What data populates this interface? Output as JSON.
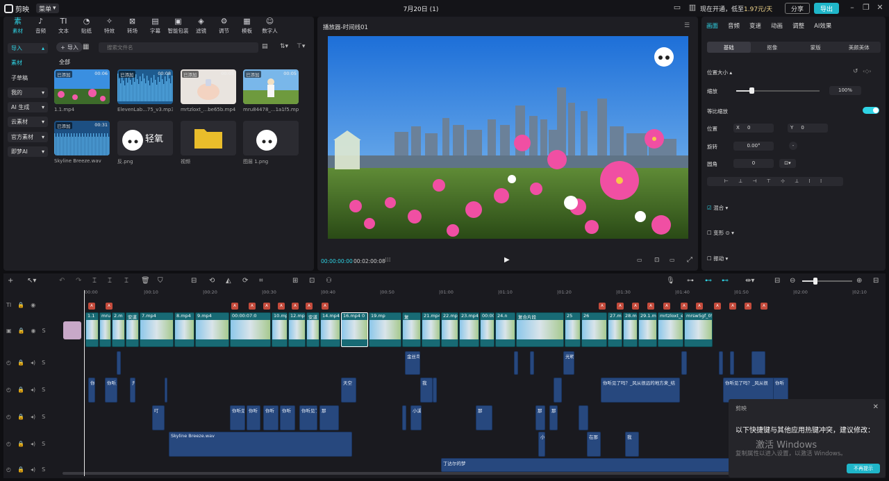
{
  "app": {
    "name": "剪映",
    "menu_label": "菜单",
    "doc_title": "7月20日 (1)",
    "promo_prefix": "现在开通，低至",
    "promo_price": "1.97元/天",
    "share": "分享",
    "export": "导出"
  },
  "toolbar_tabs": [
    {
      "label": "素材",
      "icon": "素"
    },
    {
      "label": "音频",
      "icon": "♪"
    },
    {
      "label": "文本",
      "icon": "TI"
    },
    {
      "label": "贴纸",
      "icon": "◔"
    },
    {
      "label": "特效",
      "icon": "✧"
    },
    {
      "label": "转场",
      "icon": "⊠"
    },
    {
      "label": "字幕",
      "icon": "▤"
    },
    {
      "label": "智能包装",
      "icon": "▣"
    },
    {
      "label": "滤镜",
      "icon": "◈"
    },
    {
      "label": "调节",
      "icon": "⚙"
    },
    {
      "label": "模板",
      "icon": "▦"
    },
    {
      "label": "数字人",
      "icon": "☺"
    }
  ],
  "sidebar": [
    {
      "label": "导入",
      "active": true
    },
    {
      "label": "素材",
      "active": true
    },
    {
      "label": "子草稿"
    },
    {
      "label": "我的"
    },
    {
      "label": "AI 生成"
    },
    {
      "label": "云素材"
    },
    {
      "label": "官方素材"
    },
    {
      "label": "即梦AI"
    }
  ],
  "media": {
    "import_label": "导入",
    "search_placeholder": "搜索文件名",
    "all_label": "全部",
    "items": [
      {
        "name": "1.1.mp4",
        "badge": "已添加",
        "duration": "00:06",
        "kind": "flowers"
      },
      {
        "name": "ElevenLab...75_v3.mp3",
        "badge": "已添加",
        "duration": "00:08",
        "kind": "audio"
      },
      {
        "name": "mrtzloxt_...be65b.mp4",
        "badge": "已添加",
        "duration": "00:05",
        "kind": "hand"
      },
      {
        "name": "mru84478_...1a1f5.mp4",
        "badge": "已添加",
        "duration": "00:05",
        "kind": "girl"
      },
      {
        "name": "Skyline Breeze.wav",
        "badge": "已添加",
        "duration": "00:31",
        "kind": "wave"
      },
      {
        "name": "反.png",
        "badge": "",
        "duration": "",
        "kind": "logo",
        "logo_text": "轻氧"
      },
      {
        "name": "视频",
        "badge": "",
        "duration": "",
        "kind": "folder"
      },
      {
        "name": "图层 1.png",
        "badge": "",
        "duration": "",
        "kind": "logo2"
      }
    ]
  },
  "player": {
    "title": "播放器-时间线01",
    "time_current": "00:00:00:00",
    "time_total": "00:02:00:08"
  },
  "inspector": {
    "tabs": [
      "画面",
      "音频",
      "变速",
      "动画",
      "调整",
      "AI效果"
    ],
    "subtabs": [
      "基础",
      "抠像",
      "蒙版",
      "美颜美体"
    ],
    "section_size": "位置大小",
    "scale_label": "缩放",
    "scale_value": "100%",
    "uniform_label": "等比缩放",
    "pos_label": "位置",
    "pos_x_label": "X",
    "pos_x": "0",
    "pos_y_label": "Y",
    "pos_y": "0",
    "rot_label": "旋转",
    "rot_value": "0.00°",
    "corner_label": "圆角",
    "corner_value": "0",
    "blend_label": "混合",
    "deform_label": "变形",
    "stabilize_label": "振动"
  },
  "timeline": {
    "ruler": [
      "00:00",
      "|00:10",
      "|00:20",
      "|00:30",
      "|00:40",
      "|00:50",
      "|01:00",
      "|01:10",
      "|01:20",
      "|01:30",
      "|01:40",
      "|01:50",
      "|02:00",
      "|02:10"
    ],
    "video_clips": [
      "1.1",
      "mrui",
      "2.m",
      "安道",
      "7.mp4",
      "8.mp4",
      "9.mp4",
      "00:00:07:0",
      "10.mp",
      "12.mp",
      "安道",
      "14.mp4",
      "16.mp4 0",
      "19.mp",
      "复",
      "21.mp4",
      "22.mp",
      "23.mp4",
      "00:00:12:02",
      "24.n",
      "复合片段",
      "25",
      "26",
      "27.mp4",
      "28.mp4",
      "29.1.mp4",
      "mrtzloxt_ea",
      "mrsw5gf_05cc36257e9a8"
    ],
    "audio_row1": [
      "金丝鸟",
      "光明"
    ],
    "audio_row2": [
      "你听",
      "你听见",
      "开",
      "天空",
      "我",
      "你听见了吗？_风从很远的地方来_结",
      "你听见了吗？_风从很",
      "你听"
    ],
    "audio_row3": [
      "叮",
      "你听见",
      "你听",
      "你听",
      "你听",
      "你听见了",
      "那",
      "小溪小",
      "那",
      "那",
      "那"
    ],
    "audio_row4": [
      "Skyline Breeze.wav",
      "小",
      "在那",
      "我"
    ],
    "audio_row5": [
      "丁达尔的梦"
    ]
  },
  "toast": {
    "brand": "剪映",
    "message": "以下快捷键与其他应用热键冲突，建议修改：",
    "button": "不再提示"
  },
  "watermark": {
    "line1": "激活 Windows",
    "line2": "复制属性以进入设置，以激活 Windows。"
  }
}
